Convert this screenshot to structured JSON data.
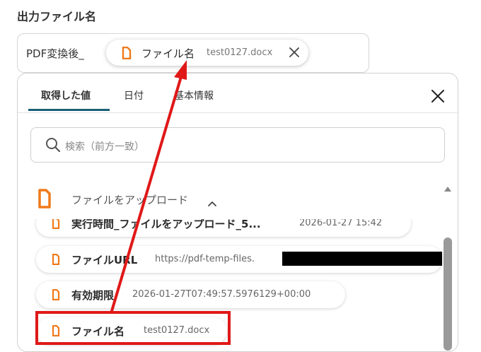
{
  "field": {
    "label": "出力ファイル名",
    "prefix": "PDF変換後_",
    "token": {
      "label": "ファイル名",
      "value": "test0127.docx",
      "icon": "file-icon",
      "remove_icon": "close-icon"
    }
  },
  "panel": {
    "tabs": [
      {
        "label": "取得した値",
        "active": true
      },
      {
        "label": "日付",
        "active": false
      },
      {
        "label": "基本情報",
        "active": false
      }
    ],
    "close_icon": "close-icon",
    "search": {
      "placeholder": "検索（前方一致）",
      "icon": "search-icon"
    },
    "group": {
      "label": "ファイルをアップロード",
      "icon": "file-icon",
      "expanded": true,
      "chevron_icon": "chevron-up-icon"
    },
    "items": [
      {
        "label": "実行時間_ファイルをアップロード_5...",
        "value": "2026-01-27 15:42"
      },
      {
        "label": "ファイルURL",
        "value": "https://pdf-temp-files.",
        "redacted": true
      },
      {
        "label": "有効期限",
        "value": "2026-01-27T07:49:57.5976129+00:00"
      },
      {
        "label": "ファイル名",
        "value": "test0127.docx",
        "highlighted": true
      }
    ]
  },
  "colors": {
    "accent": "#1b5f74",
    "file_icon": "#f07a1a",
    "annotation": "#e01818",
    "scrollbar": "#9a9a9a"
  }
}
